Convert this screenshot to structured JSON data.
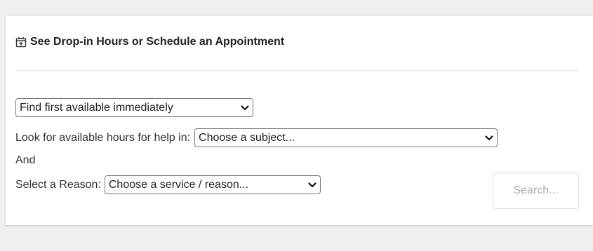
{
  "panel": {
    "title": "See Drop-in Hours or Schedule an Appointment",
    "title_icon": "calendar-plus-icon"
  },
  "form": {
    "availability_select": {
      "value": "Find first available immediately",
      "icon": "chevron-down-icon"
    },
    "subject_label": "Look for available hours for help in:",
    "subject_select": {
      "value": "Choose a subject...",
      "icon": "chevron-down-icon"
    },
    "and_text": "And",
    "reason_label": "Select a Reason:",
    "reason_select": {
      "value": "Choose a service / reason...",
      "icon": "chevron-down-icon"
    },
    "search_button_label": "Search..."
  },
  "colors": {
    "page_background": "#efefef",
    "panel_background": "#ffffff",
    "text": "#333333",
    "disabled_text": "#aaaaaa",
    "border": "#767676"
  }
}
